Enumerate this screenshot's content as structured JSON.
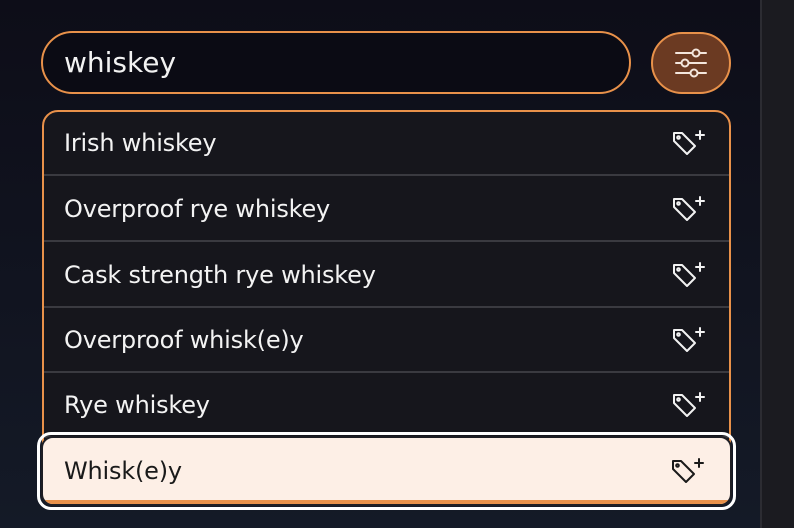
{
  "search": {
    "value": "whiskey"
  },
  "filter_button": {
    "icon": "sliders-icon"
  },
  "results": [
    {
      "label": "Irish whiskey",
      "icon": "tag-plus-icon"
    },
    {
      "label": "Overproof rye whiskey",
      "icon": "tag-plus-icon"
    },
    {
      "label": "Cask strength rye whiskey",
      "icon": "tag-plus-icon"
    },
    {
      "label": "Overproof whisk(e)y",
      "icon": "tag-plus-icon"
    },
    {
      "label": "Rye whiskey",
      "icon": "tag-plus-icon"
    }
  ],
  "selected_result": {
    "label": "Whisk(e)y",
    "icon": "tag-plus-icon"
  },
  "colors": {
    "accent": "#e8914a",
    "filter_button_bg": "#6b3a22",
    "list_bg": "#16161c",
    "selected_bg": "#fdefe6"
  }
}
